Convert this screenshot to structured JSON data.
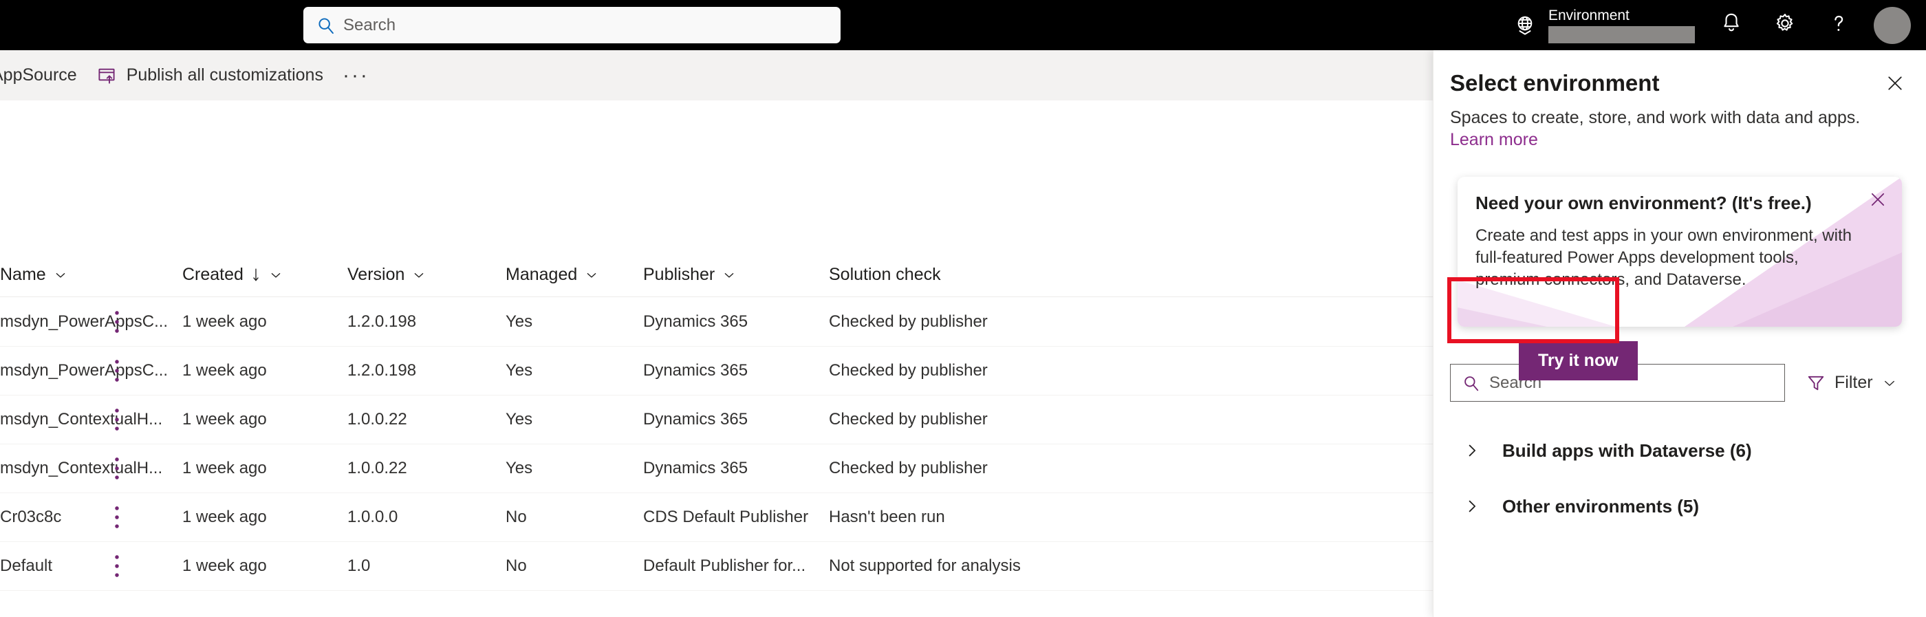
{
  "suite": {
    "search_placeholder": "Search",
    "env_label": "Environment",
    "icons": {
      "search": "search-icon",
      "globe": "globe-icon",
      "bell": "notifications-bell-icon",
      "gear": "settings-gear-icon",
      "help": "help-question-icon",
      "avatar": "user-avatar"
    }
  },
  "command_bar": {
    "appsource": "AppSource",
    "publish_all": "Publish all customizations",
    "overflow": "···"
  },
  "grid": {
    "columns": [
      {
        "label": "Name",
        "sortable": true,
        "sorted": false
      },
      {
        "label": "Created",
        "sortable": true,
        "sorted": true,
        "sort_dir": "↓"
      },
      {
        "label": "Version",
        "sortable": true,
        "sorted": false
      },
      {
        "label": "Managed",
        "sortable": true,
        "sorted": false
      },
      {
        "label": "Publisher",
        "sortable": true,
        "sorted": false
      },
      {
        "label": "Solution check",
        "sortable": false,
        "sorted": false
      }
    ],
    "rows": [
      {
        "name": "msdyn_PowerAppsC...",
        "created": "1 week ago",
        "version": "1.2.0.198",
        "managed": "Yes",
        "publisher": "Dynamics 365",
        "solution_check": "Checked by publisher"
      },
      {
        "name": "msdyn_PowerAppsC...",
        "created": "1 week ago",
        "version": "1.2.0.198",
        "managed": "Yes",
        "publisher": "Dynamics 365",
        "solution_check": "Checked by publisher"
      },
      {
        "name": "msdyn_ContextualH...",
        "created": "1 week ago",
        "version": "1.0.0.22",
        "managed": "Yes",
        "publisher": "Dynamics 365",
        "solution_check": "Checked by publisher"
      },
      {
        "name": "msdyn_ContextualH...",
        "created": "1 week ago",
        "version": "1.0.0.22",
        "managed": "Yes",
        "publisher": "Dynamics 365",
        "solution_check": "Checked by publisher"
      },
      {
        "name": "Cr03c8c",
        "created": "1 week ago",
        "version": "1.0.0.0",
        "managed": "No",
        "publisher": "CDS Default Publisher",
        "solution_check": "Hasn't been run"
      },
      {
        "name": "Default",
        "created": "1 week ago",
        "version": "1.0",
        "managed": "No",
        "publisher": "Default Publisher for...",
        "solution_check": "Not supported for analysis"
      }
    ]
  },
  "panel": {
    "title": "Select environment",
    "subtitle": "Spaces to create, store, and work with data and apps.",
    "learn_more": "Learn more",
    "search_placeholder": "Search",
    "filter_label": "Filter",
    "groups": [
      {
        "label": "Build apps with Dataverse (6)"
      },
      {
        "label": "Other environments (5)"
      }
    ]
  },
  "callout": {
    "title": "Need your own environment? (It's free.)",
    "body": "Create and test apps in your own environment, with full-featured Power Apps development tools, premium connectors, and Dataverse.",
    "button": "Try it now"
  },
  "colors": {
    "brand_purple": "#742774",
    "link_purple": "#8d2d8d",
    "highlight_red": "#e81123",
    "suite_bar": "#000000",
    "command_bar": "#f3f2f1"
  }
}
